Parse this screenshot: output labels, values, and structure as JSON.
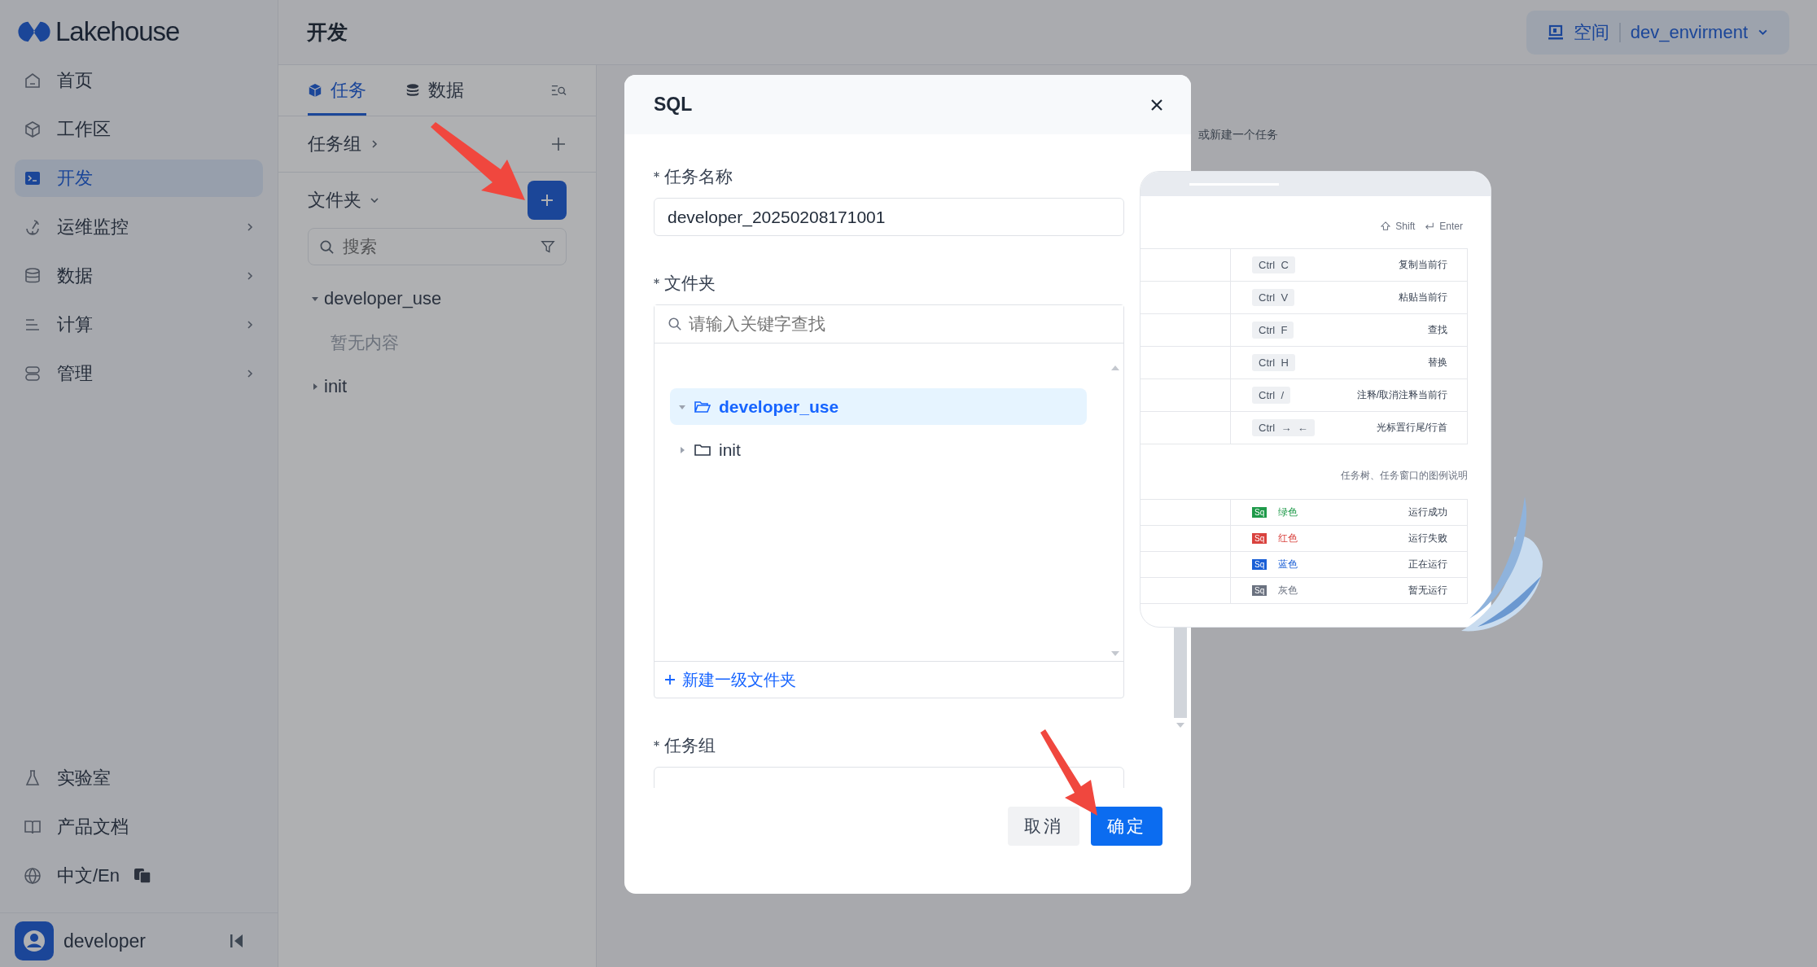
{
  "logo": {
    "text": "Lakehouse"
  },
  "sidebar": {
    "items": [
      {
        "label": "首页",
        "selected": false,
        "has_submenu": false
      },
      {
        "label": "工作区",
        "selected": false,
        "has_submenu": false
      },
      {
        "label": "开发",
        "selected": true,
        "has_submenu": false
      },
      {
        "label": "运维监控",
        "selected": false,
        "has_submenu": true
      },
      {
        "label": "数据",
        "selected": false,
        "has_submenu": true
      },
      {
        "label": "计算",
        "selected": false,
        "has_submenu": true
      },
      {
        "label": "管理",
        "selected": false,
        "has_submenu": true
      }
    ],
    "bottom_items": [
      {
        "label": "实验室"
      },
      {
        "label": "产品文档"
      },
      {
        "label": "中文/En"
      }
    ],
    "user": "developer"
  },
  "header": {
    "title": "开发",
    "space_label": "空间",
    "space_value": "dev_envirment"
  },
  "panel": {
    "tabs": [
      {
        "label": "任务",
        "selected": true
      },
      {
        "label": "数据",
        "selected": false
      }
    ],
    "task_group_label": "任务组",
    "folder_label": "文件夹",
    "search": {
      "placeholder": "搜索"
    },
    "tree": [
      {
        "label": "developer_use",
        "expanded": true,
        "empty_text": "暂无内容"
      },
      {
        "label": "init",
        "expanded": false
      }
    ]
  },
  "main": {
    "hint": "或新建一个任务",
    "modifier_keys": [
      "Shift",
      "Enter"
    ],
    "shortcuts": [
      {
        "keys": [
          "Ctrl",
          "C"
        ],
        "action": "复制当前行"
      },
      {
        "keys": [
          "Ctrl",
          "V"
        ],
        "action": "粘贴当前行"
      },
      {
        "keys": [
          "Ctrl",
          "F"
        ],
        "action": "查找"
      },
      {
        "keys": [
          "Ctrl",
          "H"
        ],
        "action": "替换"
      },
      {
        "keys": [
          "Ctrl",
          "/"
        ],
        "action": "注释/取消注释当前行"
      },
      {
        "keys": [
          "Ctrl",
          "→",
          "←"
        ],
        "action": "光标置行尾/行首"
      }
    ],
    "legend_title": "任务树、任务窗口的图例说明",
    "legend": [
      {
        "badge": "Sq",
        "color": "#1f9a4a",
        "name": "绿色",
        "meaning": "运行成功"
      },
      {
        "badge": "Sq",
        "color": "#d9433f",
        "name": "红色",
        "meaning": "运行失败"
      },
      {
        "badge": "Sq",
        "color": "#1a5fd6",
        "name": "蓝色",
        "meaning": "正在运行"
      },
      {
        "badge": "Sq",
        "color": "#6b7280",
        "name": "灰色",
        "meaning": "暂无运行"
      }
    ]
  },
  "dialog": {
    "title": "SQL",
    "fields": [
      {
        "kind": "text",
        "label": "任务名称",
        "required": true,
        "value": "developer_20250208171001"
      },
      {
        "kind": "folder",
        "label": "文件夹",
        "required": true,
        "placeholder": "请输入关键字查找",
        "tree": [
          {
            "label": "developer_use",
            "selected": true,
            "expanded": true
          },
          {
            "label": "init",
            "selected": false,
            "expanded": false
          }
        ],
        "add_label": "新建一级文件夹"
      },
      {
        "kind": "text",
        "label": "任务组",
        "required": true
      }
    ],
    "buttons": [
      {
        "label": "取消",
        "primary": false
      },
      {
        "label": "确定",
        "primary": true
      }
    ]
  }
}
